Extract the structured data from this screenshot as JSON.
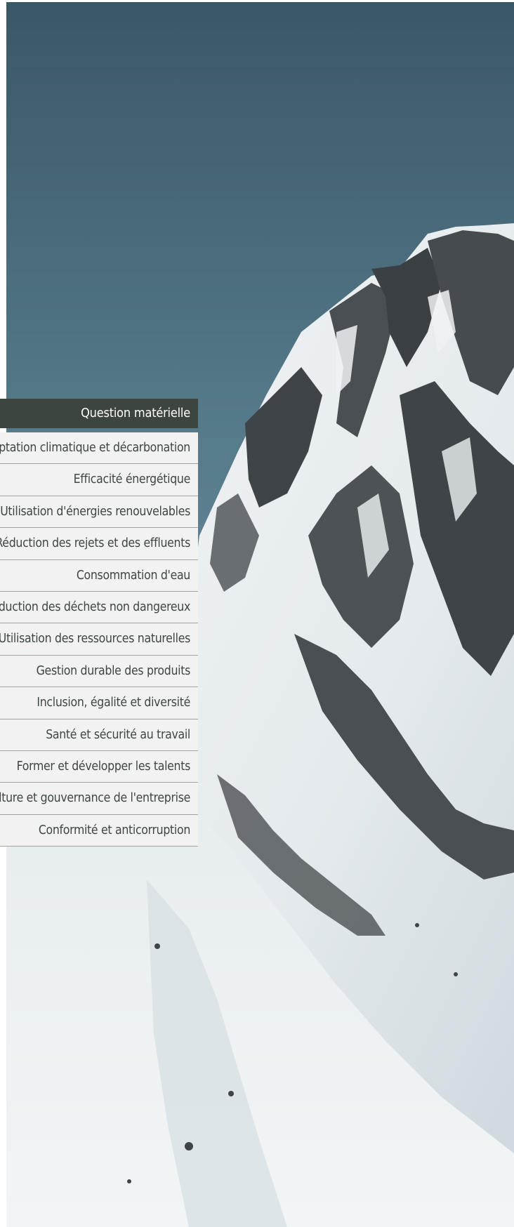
{
  "table": {
    "header": "Question matérielle",
    "rows": [
      "Adaptation climatique et décarbonation",
      "Efficacité énergétique",
      "Utilisation d'énergies renouvelables",
      "Réduction des rejets et des effluents",
      "Consommation d'eau",
      "Réduction des déchets non dangereux",
      "Utilisation des ressources naturelles",
      "Gestion durable des produits",
      "Inclusion, égalité et diversité",
      "Santé et sécurité au travail",
      "Former et développer les talents",
      "Culture et gouvernance de l'entreprise",
      "Conformité et anticorruption"
    ]
  },
  "colors": {
    "header_bg": "#3d4540",
    "row_bg": "#f1f2f1",
    "row_border": "#9ea4a0",
    "text": "#3f4642",
    "sky": "#4a6c7c",
    "snow": "#edf1f3"
  }
}
